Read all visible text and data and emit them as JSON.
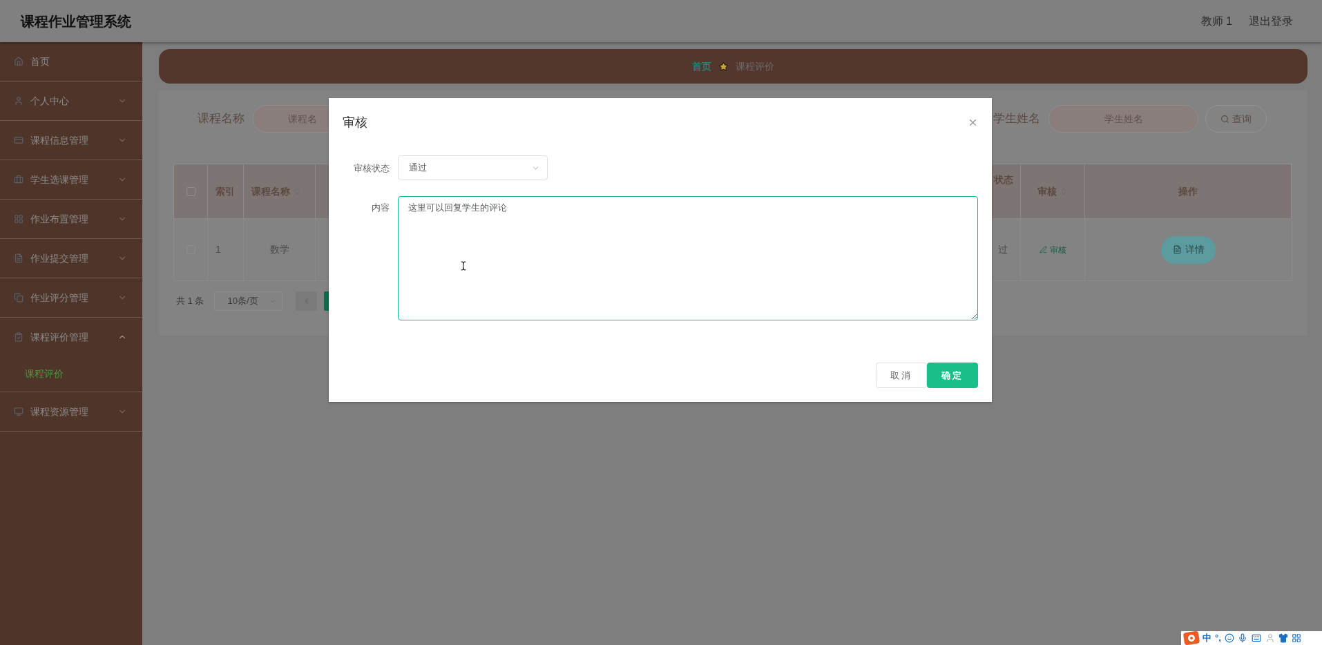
{
  "header": {
    "title": "课程作业管理系统",
    "user": "教师 1",
    "logout": "退出登录"
  },
  "sidebar": {
    "items": [
      {
        "label": "首页",
        "kind": "link"
      },
      {
        "label": "个人中心",
        "kind": "group",
        "expanded": false
      },
      {
        "label": "课程信息管理",
        "kind": "group",
        "expanded": false
      },
      {
        "label": "学生选课管理",
        "kind": "group",
        "expanded": false
      },
      {
        "label": "作业布置管理",
        "kind": "group",
        "expanded": false
      },
      {
        "label": "作业提交管理",
        "kind": "group",
        "expanded": false
      },
      {
        "label": "作业评分管理",
        "kind": "group",
        "expanded": false
      },
      {
        "label": "课程评价管理",
        "kind": "group",
        "expanded": true,
        "children": [
          {
            "label": "课程评价",
            "selected": true
          }
        ]
      },
      {
        "label": "课程资源管理",
        "kind": "group",
        "expanded": false
      }
    ]
  },
  "breadcrumb": [
    {
      "label": "首页",
      "current": false
    },
    {
      "label": "课程评价",
      "current": true
    }
  ],
  "search": {
    "fields": [
      {
        "label": "课程名称",
        "placeholder": "课程名"
      },
      {
        "label": "学生姓名",
        "placeholder": "学生姓名"
      }
    ],
    "button": "查询"
  },
  "table": {
    "header_checked": false,
    "columns": [
      {
        "label": "索引",
        "sortable": false
      },
      {
        "label": "课程名称",
        "sortable": true
      },
      {
        "label": "状态",
        "sortable": false
      },
      {
        "label": "审核",
        "sortable": true
      },
      {
        "label": "操作",
        "sortable": false
      }
    ],
    "rows": [
      {
        "checked": false,
        "index": "1",
        "course": "数学",
        "status": "过",
        "review": "审核",
        "action": "详情"
      }
    ]
  },
  "pagination": {
    "total": "共 1 条",
    "page_size": "10条/页",
    "pages": [
      {
        "selected": true
      }
    ]
  },
  "dialog": {
    "title": "审核",
    "fields": [
      {
        "kind": "select",
        "label": "审核状态",
        "value": "通过"
      },
      {
        "kind": "textarea",
        "label": "内容",
        "value": "这里可以回复学生的评论",
        "focused": true
      }
    ],
    "buttons": [
      {
        "label": "取消",
        "primary": false
      },
      {
        "label": "确定",
        "primary": true
      }
    ]
  },
  "ime_toolbar": {
    "mode": "中",
    "punct": "°,"
  }
}
